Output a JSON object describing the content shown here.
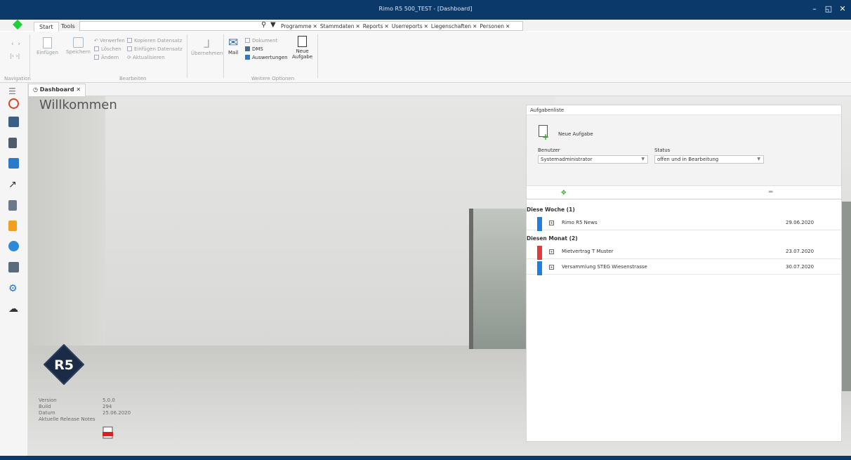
{
  "window": {
    "title": "Rimo R5 500_TEST - [Dashboard]"
  },
  "ribbon": {
    "tabs": [
      "Start",
      "Tools"
    ],
    "search": {
      "value": "",
      "placeholder": ""
    },
    "quick_tabs": [
      "Programme",
      "Stammdaten",
      "Reports",
      "Userreports",
      "Liegenschaften",
      "Personen"
    ],
    "navigation": {
      "label": "Navigation"
    },
    "bearbeiten": {
      "label": "Bearbeiten",
      "einfuegen": "Einfügen",
      "speichern": "Speichern",
      "verwerfen": "Verwerfen",
      "loeschen": "Löschen",
      "aendern": "Ändern",
      "kopieren_datensatz": "Kopieren Datensatz",
      "einfuegen_datensatz": "Einfügen Datensatz",
      "aktualisieren": "Aktualisieren",
      "uebernehmen": "Übernehmen"
    },
    "weitere": {
      "label": "Weitere Optionen",
      "mail": "Mail",
      "dokument": "Dokument",
      "dms": "DMS",
      "auswertungen": "Auswertungen",
      "neue_aufgabe_1": "Neue",
      "neue_aufgabe_2": "Aufgabe"
    }
  },
  "doc_tab": {
    "label": "Dashboard"
  },
  "dashboard": {
    "welcome": "Willkommen",
    "logo_text": "R5",
    "info": [
      {
        "label": "Version",
        "value": "5.0.0"
      },
      {
        "label": "Build",
        "value": "294"
      },
      {
        "label": "Datum",
        "value": "25.06.2020"
      },
      {
        "label": "Aktuelle Release Notes",
        "value": ""
      }
    ]
  },
  "tasks": {
    "header": "Aufgabenliste",
    "new_task": "Neue Aufgabe",
    "user_label": "Benutzer",
    "user_value": "Systemadministrator",
    "status_label": "Status",
    "status_value": "offen und in Bearbeitung",
    "groups": [
      {
        "title": "Diese Woche (1)",
        "rows": [
          {
            "name": "Rimo R5 News",
            "date": "29.06.2020",
            "color": "#1f7fe0"
          }
        ]
      },
      {
        "title": "Diesen Monat (2)",
        "rows": [
          {
            "name": "Mietvertrag T Muster",
            "date": "23.07.2020",
            "color": "#e23a3a"
          },
          {
            "name": "Versammlung STEG Wiesenstrasse",
            "date": "30.07.2020",
            "color": "#1f7fe0"
          }
        ]
      }
    ]
  },
  "colors": {
    "titlebar": "#0b3a6a",
    "accent_green": "#1fcf37"
  }
}
